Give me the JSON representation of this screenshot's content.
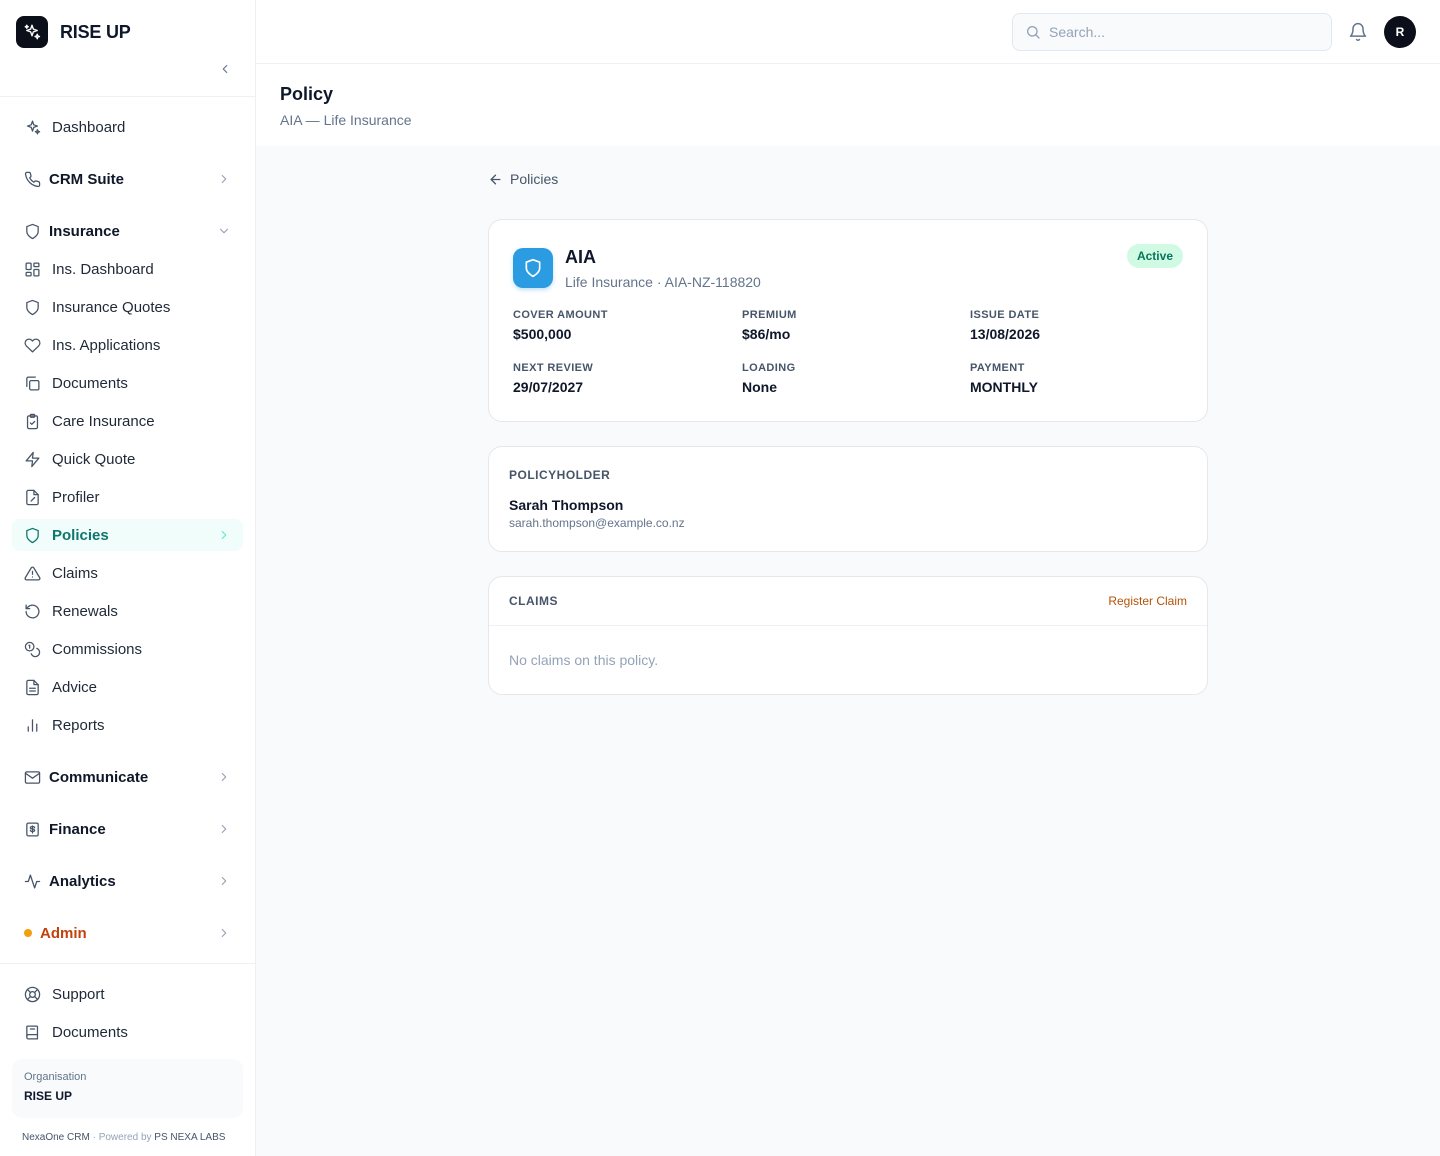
{
  "brand": {
    "name": "RISE UP"
  },
  "sidebar": {
    "items": [
      {
        "label": "Dashboard"
      },
      {
        "label": "CRM Suite"
      },
      {
        "label": "Insurance"
      },
      {
        "label": "Ins. Dashboard"
      },
      {
        "label": "Insurance Quotes"
      },
      {
        "label": "Ins. Applications"
      },
      {
        "label": "Documents"
      },
      {
        "label": "Care Insurance"
      },
      {
        "label": "Quick Quote"
      },
      {
        "label": "Profiler"
      },
      {
        "label": "Policies"
      },
      {
        "label": "Claims"
      },
      {
        "label": "Renewals"
      },
      {
        "label": "Commissions"
      },
      {
        "label": "Advice"
      },
      {
        "label": "Reports"
      },
      {
        "label": "Communicate"
      },
      {
        "label": "Finance"
      },
      {
        "label": "Analytics"
      },
      {
        "label": "Admin"
      }
    ],
    "bottom": [
      {
        "label": "Support"
      },
      {
        "label": "Documents"
      }
    ],
    "org": {
      "label": "Organisation",
      "value": "RISE UP"
    },
    "footer": {
      "product": "NexaOne CRM",
      "sep": " · Powered by ",
      "company": "PS NEXA LABS"
    }
  },
  "topbar": {
    "search_placeholder": "Search...",
    "avatar_initial": "R"
  },
  "header": {
    "title": "Policy",
    "subtitle": "AIA — Life Insurance"
  },
  "main": {
    "back_label": "Policies",
    "policy": {
      "insurer": "AIA",
      "meta": "Life Insurance · AIA-NZ-118820",
      "status": "Active",
      "fields": [
        {
          "label": "Cover Amount",
          "value": "$500,000"
        },
        {
          "label": "Premium",
          "value": "$86/mo"
        },
        {
          "label": "Issue Date",
          "value": "13/08/2026"
        },
        {
          "label": "Next Review",
          "value": "29/07/2027"
        },
        {
          "label": "Loading",
          "value": "None"
        },
        {
          "label": "Payment",
          "value": "MONTHLY"
        }
      ]
    },
    "policyholder": {
      "section_label": "Policyholder",
      "name": "Sarah Thompson",
      "email": "sarah.thompson@example.co.nz"
    },
    "claims": {
      "section_label": "Claims",
      "action_label": "Register Claim",
      "empty_text": "No claims on this policy."
    }
  },
  "colors": {
    "accent": "#0f766e",
    "accent_bg": "#f0fdfa",
    "status_bg": "#d1fae5",
    "status_text": "#047857",
    "admin": "#c2410c",
    "register_link": "#b45309",
    "insurer_icon": "#2b9be2"
  },
  "icons": {
    "brand": "sparkles-icon",
    "search": "search-icon",
    "bell": "bell-icon",
    "back": "arrow-left-icon",
    "insurer": "shield-icon"
  }
}
